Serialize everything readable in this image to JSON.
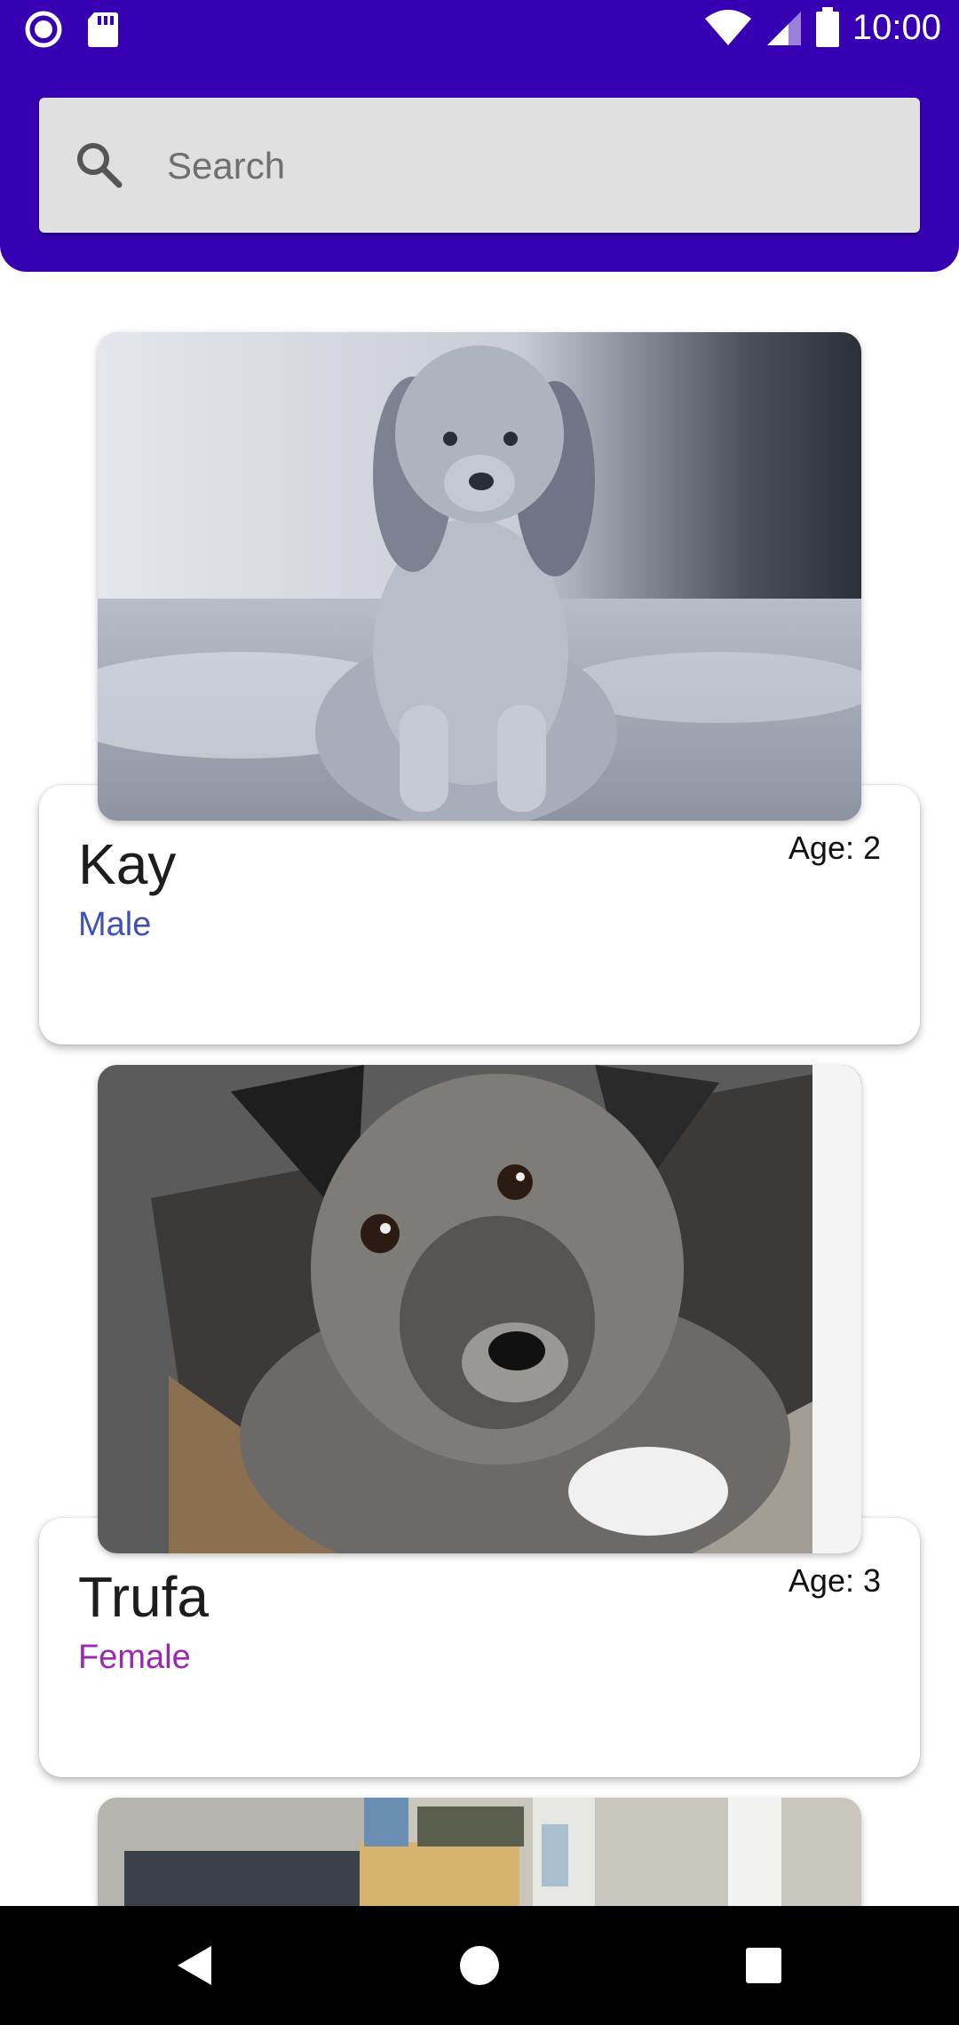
{
  "status_bar": {
    "time": "10:00",
    "icons": [
      "notification-dot-icon",
      "sd-card-icon",
      "wifi-icon",
      "signal-icon",
      "battery-icon"
    ]
  },
  "search": {
    "placeholder": "Search",
    "value": ""
  },
  "pets": [
    {
      "name": "Kay",
      "sex": "Male",
      "age_label": "Age:",
      "age": "2",
      "sex_color": "#3f51b5"
    },
    {
      "name": "Trufa",
      "sex": "Female",
      "age_label": "Age:",
      "age": "3",
      "sex_color": "#9c27b0"
    }
  ],
  "colors": {
    "header": "#3700b3",
    "search_bg": "#e0e0e0",
    "male": "#3f51b5",
    "female": "#9c27b0"
  },
  "nav": {
    "icons": [
      "back-icon",
      "home-icon",
      "recents-icon"
    ]
  }
}
